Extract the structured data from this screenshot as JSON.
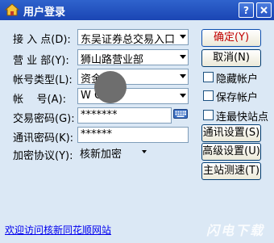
{
  "window": {
    "title": "用户登录",
    "help_label": "?",
    "close_label": "×"
  },
  "form": {
    "fields": [
      {
        "label": "接 入 点(D):",
        "value": "东吴证券总交易入口"
      },
      {
        "label": "营 业 部(Y):",
        "value": "狮山路营业部"
      },
      {
        "label": "帐号类型(L):",
        "value": "资金帐户"
      },
      {
        "label": "帐    号(A):",
        "value": "W                  OM"
      },
      {
        "label": "交易密码(G):",
        "value": "*******"
      },
      {
        "label": "通讯密码(K):",
        "value": "******"
      },
      {
        "label": "加密协议(Y):",
        "value": "核新加密"
      }
    ]
  },
  "buttons": {
    "ok": "确定(Y)",
    "cancel": "取消(N)",
    "comm_settings": "通讯设置(S)",
    "advanced_settings": "高级设置(U)",
    "station_speedtest": "主站测速(T)"
  },
  "checkboxes": {
    "hide_account": "隐藏帐户",
    "save_account": "保存帐户",
    "connect_fastest": "连最快站点"
  },
  "footer": {
    "link_text": "欢迎访问核新同花顺网站",
    "watermark": "闪电下载"
  },
  "colors": {
    "titlebar": "#2257c4",
    "window_bg": "#dbe8f5",
    "ok_text": "#c00000",
    "link": "#0000ee"
  }
}
